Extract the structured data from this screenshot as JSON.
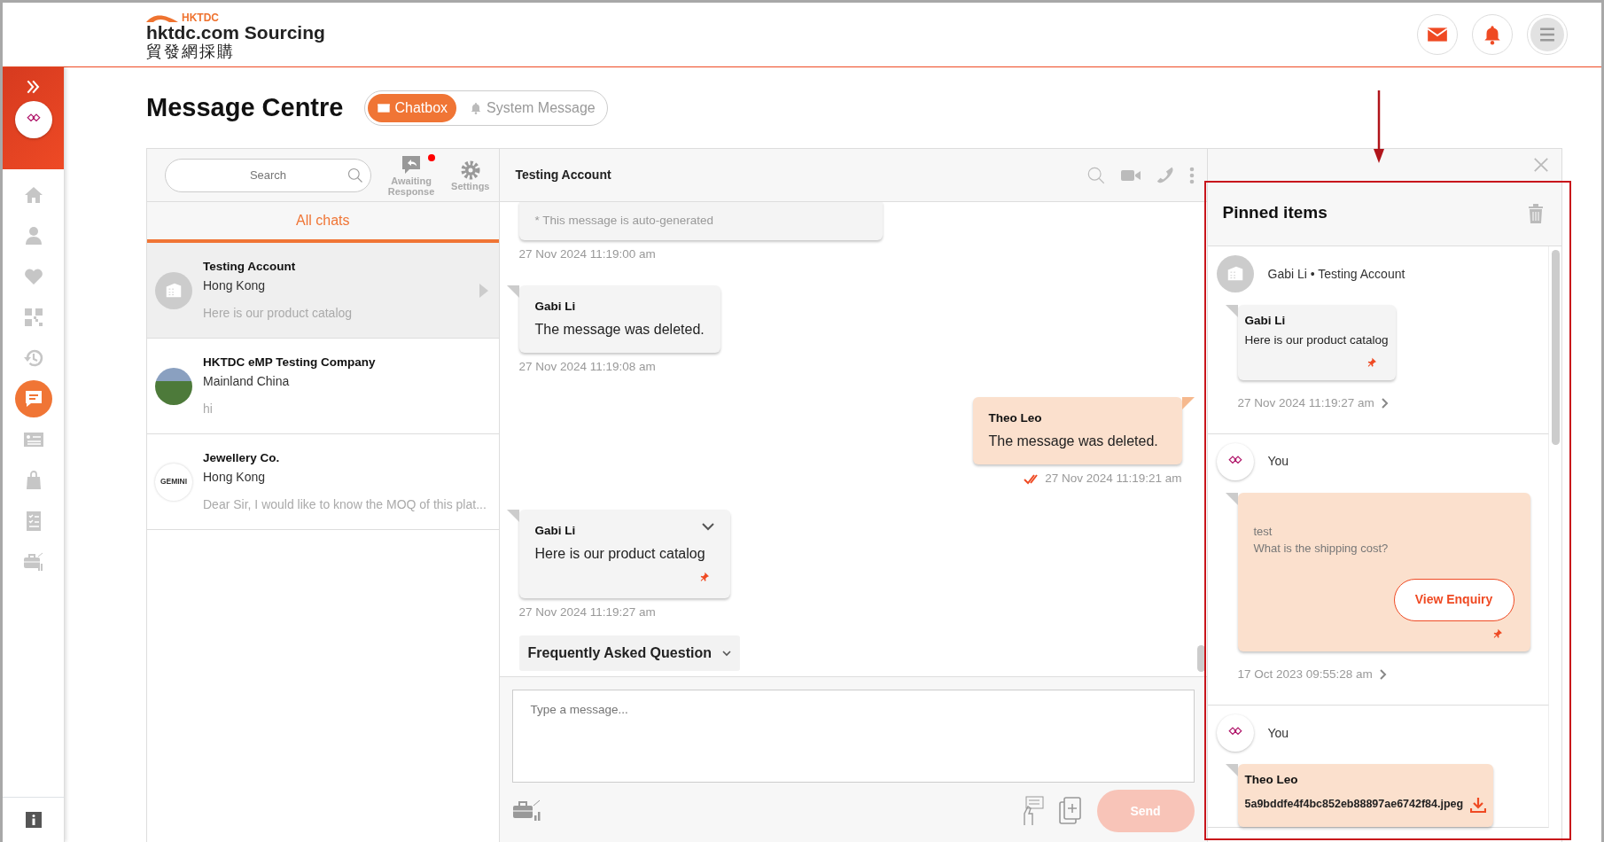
{
  "header": {
    "logo_mark": "HKTDC",
    "brand": "hktdc.com Sourcing",
    "brand_zh": "貿發網採購",
    "icons": [
      {
        "kind": "mail"
      },
      {
        "kind": "bell"
      },
      {
        "kind": "menu"
      }
    ]
  },
  "sidebar": {
    "items": [
      {
        "kind": "home",
        "selected": false
      },
      {
        "kind": "person",
        "selected": false
      },
      {
        "kind": "heart",
        "selected": false
      },
      {
        "kind": "qr",
        "selected": false
      },
      {
        "kind": "history",
        "selected": false
      },
      {
        "kind": "chat",
        "selected": true
      },
      {
        "kind": "card",
        "selected": false
      },
      {
        "kind": "bag",
        "selected": false
      },
      {
        "kind": "checklist",
        "selected": false
      },
      {
        "kind": "briefcase",
        "selected": false
      }
    ]
  },
  "page_title": "Message Centre",
  "tabs": [
    {
      "label": "Chatbox",
      "kind": "mail",
      "selected": true
    },
    {
      "label": "System Message",
      "kind": "bell",
      "selected": false
    }
  ],
  "chat_list": {
    "search": {
      "placeholder": "Search"
    },
    "tools": [
      {
        "kind": "awaiting",
        "label": "Awaiting Response",
        "alert": true
      },
      {
        "kind": "settings",
        "label": "Settings",
        "alert": false
      }
    ],
    "filter_tab": "All chats",
    "chats": [
      {
        "name": "Testing Account",
        "region": "Hong Kong",
        "preview": "Here is our product catalog",
        "avatar": {
          "kind": "building"
        },
        "selected": true
      },
      {
        "name": "HKTDC eMP Testing Company",
        "region": "Mainland China",
        "preview": "hi",
        "avatar": {
          "kind": "photo"
        },
        "selected": false
      },
      {
        "name": "Jewellery Co.",
        "region": "Hong Kong",
        "preview": "Dear Sir, I would like to know the MOQ of this plat...",
        "avatar": {
          "kind": "text",
          "text": "GEMINI"
        },
        "selected": false
      }
    ]
  },
  "conversation": {
    "title": "Testing Account",
    "messages": [
      {
        "kind": "note",
        "text": "* This message is auto-generated",
        "time": "27 Nov 2024 11:19:00 am"
      },
      {
        "kind": "incoming",
        "sender": "Gabi Li",
        "text": "The message was deleted.",
        "time": "27 Nov 2024 11:19:08 am",
        "pinned": false,
        "menu": false
      },
      {
        "kind": "outgoing",
        "sender": "Theo Leo",
        "text": "The message was deleted.",
        "time": "27 Nov 2024 11:19:21 am",
        "read": true
      },
      {
        "kind": "incoming",
        "sender": "Gabi Li",
        "text": "Here is our product catalog",
        "time": "27 Nov 2024 11:19:27 am",
        "pinned": true,
        "menu": true
      }
    ],
    "faq": "Frequently Asked Question",
    "composer": {
      "placeholder": "Type a message..."
    },
    "send": {
      "label": "Send",
      "disabled": true
    }
  },
  "pinned": {
    "title": "Pinned items",
    "items": [
      {
        "kind": "message",
        "author": "Gabi Li • Testing Account",
        "avatar": {
          "kind": "building"
        },
        "sender": "Gabi Li",
        "text": "Here is our product catalog",
        "time": "27 Nov 2024 11:19:27 am"
      },
      {
        "kind": "enquiry",
        "author": "You",
        "avatar": {
          "kind": "logo"
        },
        "lines": [
          "test",
          "What is the shipping cost?"
        ],
        "button": "View Enquiry",
        "time": "17 Oct 2023 09:55:28 am"
      },
      {
        "kind": "file",
        "author": "You",
        "avatar": {
          "kind": "logo"
        },
        "sender": "Theo Leo",
        "file": "5a9bddfe4f4bc852eb88897ae6742f84.jpeg"
      }
    ]
  },
  "annotation": {
    "arrow": true,
    "frame": true
  }
}
